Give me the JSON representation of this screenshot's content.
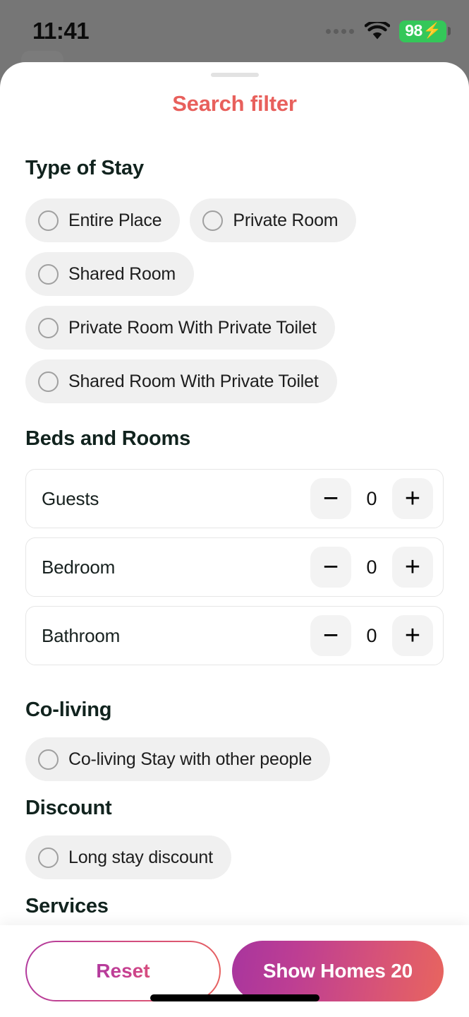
{
  "status_bar": {
    "time": "11:41",
    "battery_level": "98",
    "battery_bolt": "⚡",
    "wifi_icon": "wifi-icon",
    "signal_dots_icon": "signal-dots-icon"
  },
  "sheet": {
    "title": "Search filter",
    "drag_handle": "drag-handle"
  },
  "sections": {
    "type_of_stay": {
      "title": "Type of Stay",
      "options": [
        {
          "label": "Entire Place",
          "selected": false
        },
        {
          "label": "Private Room",
          "selected": false
        },
        {
          "label": "Shared Room",
          "selected": false
        },
        {
          "label": "Private Room With Private Toilet",
          "selected": false
        },
        {
          "label": "Shared Room With Private Toilet",
          "selected": false
        }
      ]
    },
    "beds_and_rooms": {
      "title": "Beds and Rooms",
      "steppers": [
        {
          "label": "Guests",
          "value": "0",
          "minus": "−",
          "plus": "+"
        },
        {
          "label": "Bedroom",
          "value": "0",
          "minus": "−",
          "plus": "+"
        },
        {
          "label": "Bathroom",
          "value": "0",
          "minus": "−",
          "plus": "+"
        }
      ]
    },
    "co_living": {
      "title": "Co-living",
      "options": [
        {
          "label": "Co-living Stay with other people",
          "selected": false
        }
      ]
    },
    "discount": {
      "title": "Discount",
      "options": [
        {
          "label": "Long stay discount",
          "selected": false
        }
      ]
    },
    "services": {
      "title": "Services",
      "options": [
        {
          "label": "",
          "selected": false
        },
        {
          "label": "",
          "selected": false
        },
        {
          "label": "",
          "selected": false
        }
      ]
    }
  },
  "footer": {
    "reset_label": "Reset",
    "show_homes_label": "Show Homes 20"
  },
  "colors": {
    "accent_coral": "#e8605c",
    "gradient_start": "#a8359e",
    "gradient_end": "#e8655e",
    "battery_green": "#34c759",
    "chip_bg": "#f0f0f0",
    "heading": "#11231e"
  }
}
